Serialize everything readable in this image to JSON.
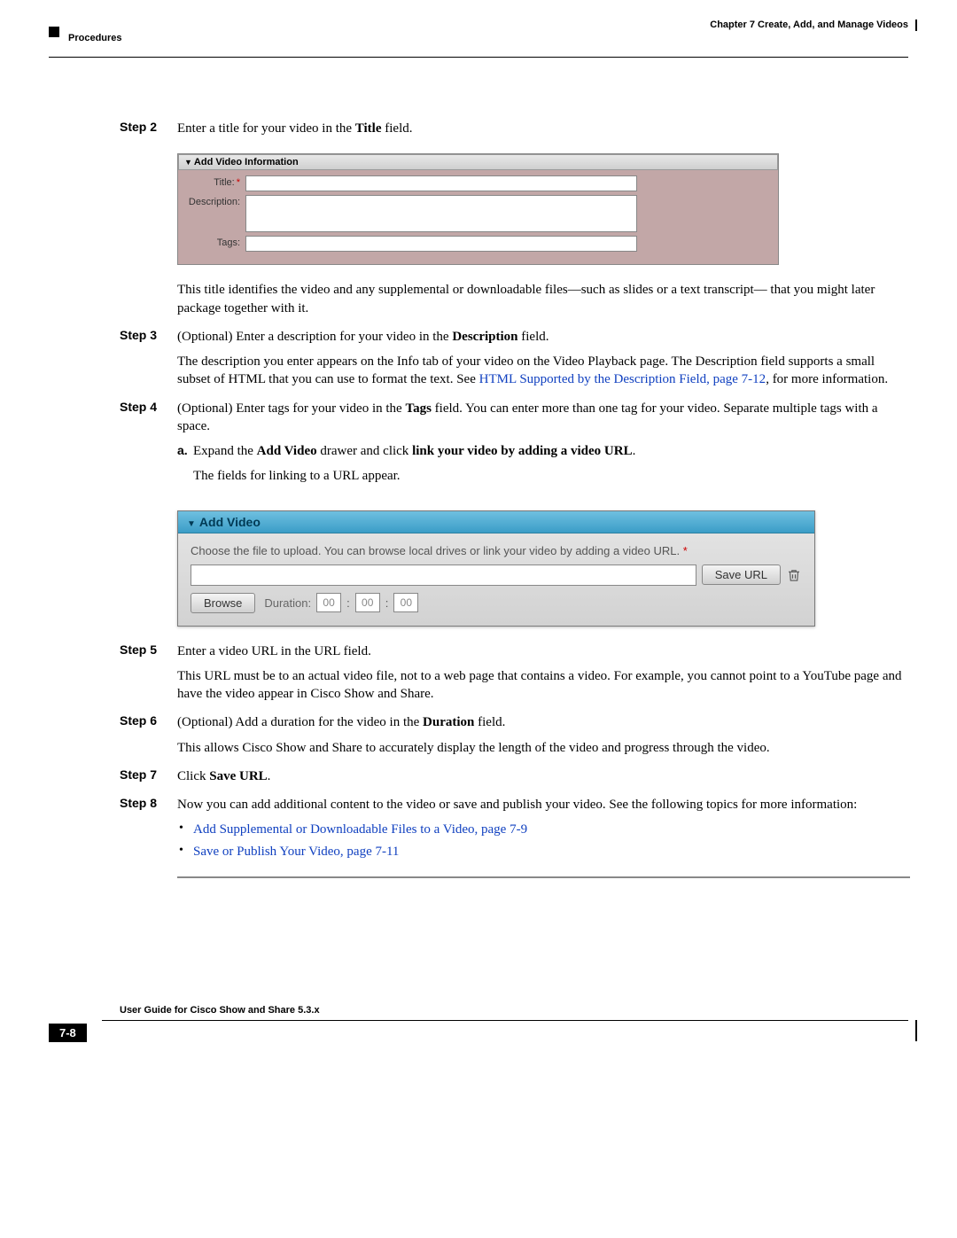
{
  "header": {
    "chapter": "Chapter 7    Create, Add, and Manage Videos",
    "section": "Procedures"
  },
  "steps": {
    "s2": {
      "label": "Step 2",
      "intro_a": "Enter a title for your video in the ",
      "intro_b": "Title",
      "intro_c": " field."
    },
    "fig1": {
      "panel_title": "Add Video Information",
      "title_label": "Title:",
      "desc_label": "Description:",
      "tags_label": "Tags:"
    },
    "s2_para": "This title identifies the video and any supplemental or downloadable files—such as slides or a text transcript— that you might later package together with it.",
    "s3": {
      "label": "Step 3",
      "line_a": "(Optional) Enter a description for your video in the ",
      "line_b": "Description",
      "line_c": " field.",
      "para_a": "The description you enter appears on the Info tab of your video on the Video Playback page. The Description field supports a small subset of HTML that you can use to format the text. See ",
      "link": "HTML Supported by the Description Field, page 7-12",
      "para_b": ", for more information."
    },
    "s4": {
      "label": "Step 4",
      "line_a": "(Optional) Enter tags for your video in the ",
      "line_b": "Tags",
      "line_c": " field. You can enter more than one tag for your video. Separate multiple tags with a space.",
      "sub_label": "a.",
      "sub_a": "Expand the ",
      "sub_b": "Add Video",
      "sub_c": " drawer and click ",
      "sub_d": "link your video by adding a video URL",
      "sub_e": ".",
      "sub_para": "The fields for linking to a URL appear."
    },
    "fig2": {
      "header": "Add Video",
      "instr": "Choose the file to upload. You can  browse local drives  or  link your video by adding a video URL.",
      "save_label": "Save URL",
      "browse_label": "Browse",
      "duration_label": "Duration:",
      "zz": "00"
    },
    "s5": {
      "label": "Step 5",
      "line": "Enter a video URL in the URL field.",
      "para": "This URL must be to an actual video file, not to a web page that contains a video. For example, you cannot point to a YouTube page and have the video appear in Cisco Show and Share."
    },
    "s6": {
      "label": "Step 6",
      "line_a": "(Optional) Add a duration for the video in the ",
      "line_b": "Duration",
      "line_c": " field.",
      "para": "This allows Cisco Show and Share to accurately display the length of the video and progress through the video."
    },
    "s7": {
      "label": "Step 7",
      "line_a": "Click ",
      "line_b": "Save URL",
      "line_c": "."
    },
    "s8": {
      "label": "Step 8",
      "line": "Now you can add additional content to the video or save and publish your video. See the following topics for more information:",
      "bullet1": "Add Supplemental or Downloadable Files to a Video, page 7-9",
      "bullet2": "Save or Publish Your Video, page 7-11"
    }
  },
  "footer": {
    "guide": "User Guide for Cisco Show and Share 5.3.x",
    "page": "7-8"
  }
}
